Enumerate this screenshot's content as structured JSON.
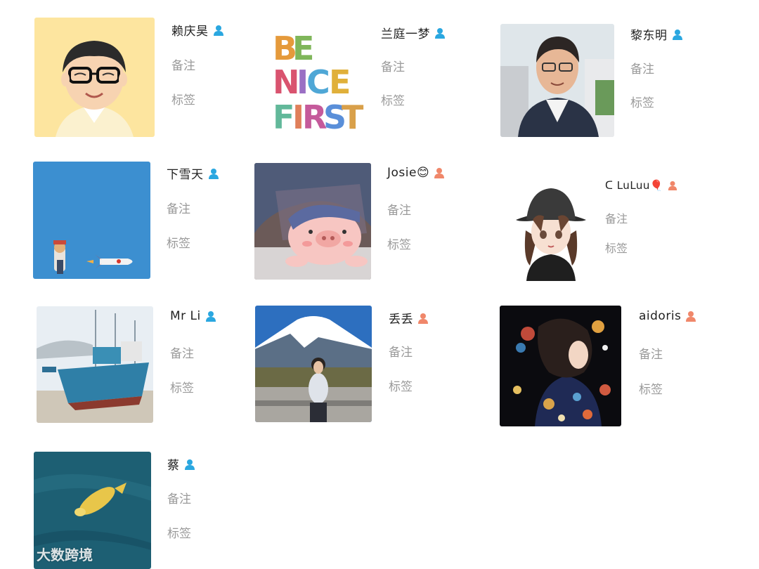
{
  "colors": {
    "male_icon": "#2aa7e0",
    "female_icon": "#f0876a",
    "field_text": "#9a9a9a",
    "name_text": "#222222"
  },
  "contacts": [
    {
      "name": "赖庆昊",
      "gender": "male",
      "note_label": "备注",
      "tag_label": "标签",
      "avatar": "cartoon-man-glasses"
    },
    {
      "name": "兰庭一梦",
      "gender": "male",
      "note_label": "备注",
      "tag_label": "标签",
      "avatar": "be-nice-first-text"
    },
    {
      "name": "黎东明",
      "gender": "male",
      "note_label": "备注",
      "tag_label": "标签",
      "avatar": "man-portrait"
    },
    {
      "name": "下雪天",
      "gender": "male",
      "note_label": "备注",
      "tag_label": "标签",
      "avatar": "toy-rocket-blue-wall"
    },
    {
      "name": "Josie😊",
      "gender": "female",
      "note_label": "备注",
      "tag_label": "标签",
      "avatar": "pink-pig-blanket"
    },
    {
      "name": "ᑕ LuLuu🎈",
      "gender": "female",
      "note_label": "备注",
      "tag_label": "标签",
      "avatar": "cartoon-girl-hat"
    },
    {
      "name": "Mr Li",
      "gender": "male",
      "note_label": "备注",
      "tag_label": "标签",
      "avatar": "fishing-boats-harbor"
    },
    {
      "name": "丢丢",
      "gender": "female",
      "note_label": "备注",
      "tag_label": "标签",
      "avatar": "woman-mount-fuji"
    },
    {
      "name": "aidoris",
      "gender": "female",
      "note_label": "备注",
      "tag_label": "标签",
      "avatar": "illustrated-girl-flowers"
    },
    {
      "name": "蔡",
      "gender": "male",
      "note_label": "备注",
      "tag_label": "标签",
      "avatar": "koi-fish-water"
    }
  ],
  "watermark": {
    "text": "大数跨境",
    "logo": "dashu-logo-icon"
  }
}
